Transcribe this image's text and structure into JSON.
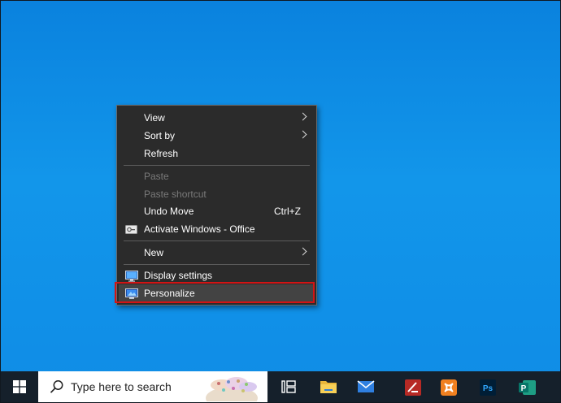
{
  "context_menu": {
    "items": [
      {
        "label": "View",
        "submenu": true
      },
      {
        "label": "Sort by",
        "submenu": true
      },
      {
        "label": "Refresh"
      },
      {
        "label": "Paste",
        "disabled": true
      },
      {
        "label": "Paste shortcut",
        "disabled": true
      },
      {
        "label": "Undo Move",
        "shortcut": "Ctrl+Z"
      },
      {
        "label": "Activate Windows - Office",
        "icon": "activation-icon"
      },
      {
        "label": "New",
        "submenu": true
      },
      {
        "label": "Display settings",
        "icon": "display-icon"
      },
      {
        "label": "Personalize",
        "icon": "personalize-icon",
        "highlighted": true
      }
    ]
  },
  "taskbar": {
    "search_placeholder": "Type here to search",
    "icons": [
      "windows-start-icon",
      "search-icon",
      "task-view-icon",
      "file-explorer-icon",
      "mail-icon",
      "filezilla-icon",
      "xampp-icon",
      "photoshop-icon",
      "publisher-icon"
    ],
    "photoshop_label": "Ps",
    "publisher_label": "P"
  },
  "colors": {
    "desktop": "#0f8ce6",
    "menu_bg": "#2b2b2b",
    "highlight_border": "#d21414",
    "taskbar": "#15202b"
  }
}
